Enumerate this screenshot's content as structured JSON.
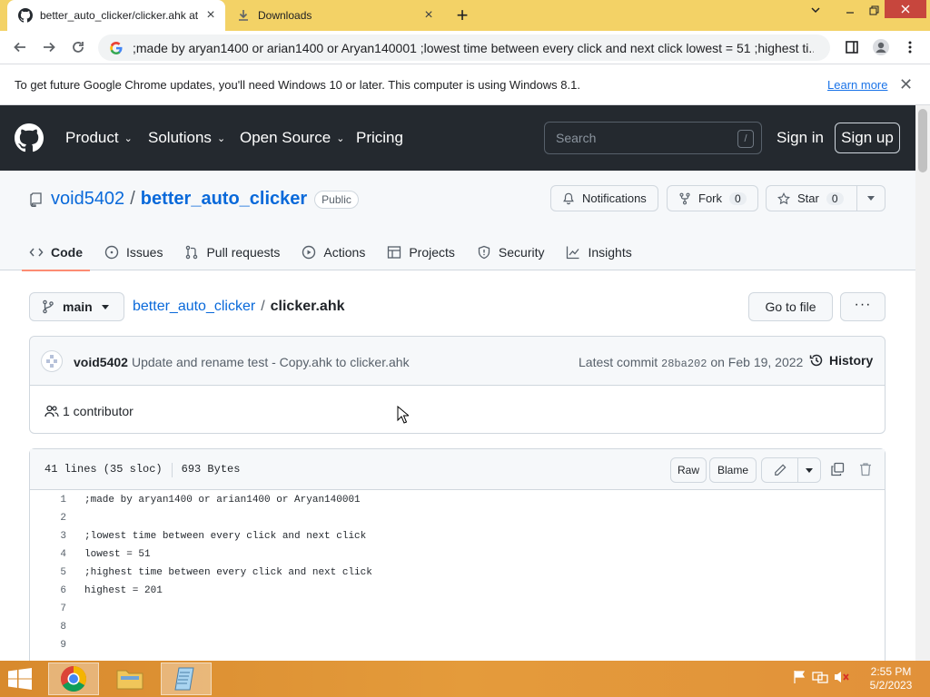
{
  "browser": {
    "tabs": [
      {
        "title": "better_auto_clicker/clicker.ahk at",
        "active": true
      },
      {
        "title": "Downloads",
        "active": false
      }
    ],
    "url": ";made by aryan1400 or arian1400 or Aryan140001 ;lowest time between every click and next click lowest = 51 ;highest ti...",
    "infobar": {
      "message": "To get future Google Chrome updates, you'll need Windows 10 or later. This computer is using Windows 8.1.",
      "link": "Learn more"
    }
  },
  "github": {
    "nav": [
      "Product",
      "Solutions",
      "Open Source",
      "Pricing"
    ],
    "search_placeholder": "Search",
    "search_key": "/",
    "signin": "Sign in",
    "signup": "Sign up"
  },
  "repo": {
    "owner": "void5402",
    "separator": "/",
    "name": "better_auto_clicker",
    "visibility": "Public",
    "notifications": "Notifications",
    "fork_label": "Fork",
    "fork_count": "0",
    "star_label": "Star",
    "star_count": "0",
    "tabs": [
      "Code",
      "Issues",
      "Pull requests",
      "Actions",
      "Projects",
      "Security",
      "Insights"
    ]
  },
  "file_nav": {
    "branch": "main",
    "crumb_repo": "better_auto_clicker",
    "crumb_sep": "/",
    "crumb_file": "clicker.ahk",
    "go_to_file": "Go to file",
    "more": "···"
  },
  "commit": {
    "author": "void5402",
    "message": "Update and rename test - Copy.ahk to clicker.ahk",
    "latest_label": "Latest commit",
    "hash": "28ba202",
    "date": "on Feb 19, 2022",
    "history": "History",
    "contributors": "1 contributor"
  },
  "file": {
    "lines_info": "41 lines (35 sloc)",
    "size": "693 Bytes",
    "raw": "Raw",
    "blame": "Blame",
    "lines": [
      {
        "n": "1",
        "code": ";made by aryan1400 or arian1400 or Aryan140001"
      },
      {
        "n": "2",
        "code": ""
      },
      {
        "n": "3",
        "code": ";lowest time between every click and next click"
      },
      {
        "n": "4",
        "code": "lowest = 51"
      },
      {
        "n": "5",
        "code": ";highest time between every click and next click"
      },
      {
        "n": "6",
        "code": "highest = 201"
      },
      {
        "n": "7",
        "code": ""
      },
      {
        "n": "8",
        "code": ""
      },
      {
        "n": "9",
        "code": ""
      }
    ]
  },
  "taskbar": {
    "time": "2:55 PM",
    "date": "5/2/2023"
  },
  "colors": {
    "tabstrip": "#f3d266",
    "github_header": "#24292f",
    "link": "#0969da",
    "taskbar": "#e49b3b"
  }
}
